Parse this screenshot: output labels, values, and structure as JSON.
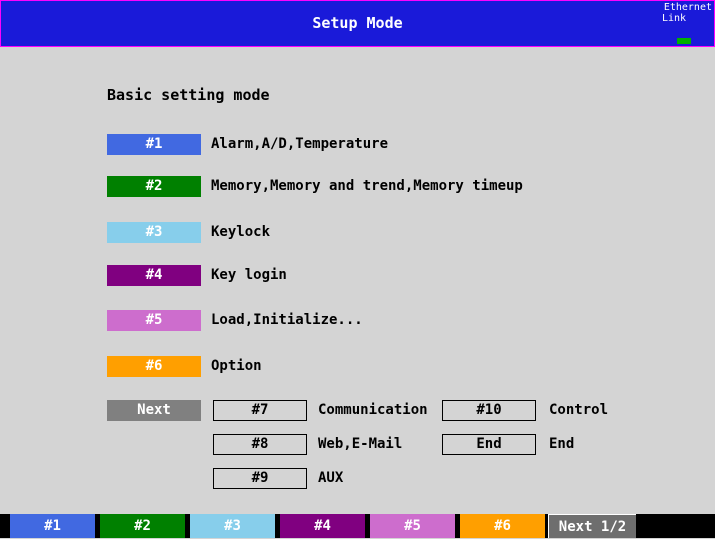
{
  "header": {
    "title": "Setup Mode",
    "ethernet_label": "Ethernet",
    "link_label": "Link"
  },
  "subtitle": "Basic setting mode",
  "colors": {
    "title_bg": "#1a1ad9",
    "title_border": "#ff00ff",
    "background": "#d4d4d4",
    "link_led": "#00b000"
  },
  "menu_items": [
    {
      "key": "#1",
      "label": "Alarm,A/D,Temperature",
      "color": "#4169e1"
    },
    {
      "key": "#2",
      "label": "Memory,Memory and trend,Memory timeup",
      "color": "#008000"
    },
    {
      "key": "#3",
      "label": "Keylock",
      "color": "#87ceeb"
    },
    {
      "key": "#4",
      "label": "Key login",
      "color": "#800080"
    },
    {
      "key": "#5",
      "label": "Load,Initialize...",
      "color": "#cd6dcd"
    },
    {
      "key": "#6",
      "label": "Option",
      "color": "#ff9f00"
    },
    {
      "key": "Next",
      "label": "",
      "color": "#808080"
    }
  ],
  "next_menu": [
    {
      "key": "#7",
      "label": "Communication"
    },
    {
      "key": "#8",
      "label": "Web,E-Mail"
    },
    {
      "key": "#9",
      "label": "AUX"
    },
    {
      "key": "#10",
      "label": "Control"
    },
    {
      "key": "End",
      "label": "End"
    }
  ],
  "softkeys": [
    {
      "label": "#1",
      "color": "#4169e1"
    },
    {
      "label": "#2",
      "color": "#008000"
    },
    {
      "label": "#3",
      "color": "#87ceeb"
    },
    {
      "label": "#4",
      "color": "#800080"
    },
    {
      "label": "#5",
      "color": "#cd6dcd"
    },
    {
      "label": "#6",
      "color": "#ff9f00"
    },
    {
      "label": "Next 1/2",
      "color": "#6e6e6e"
    }
  ]
}
